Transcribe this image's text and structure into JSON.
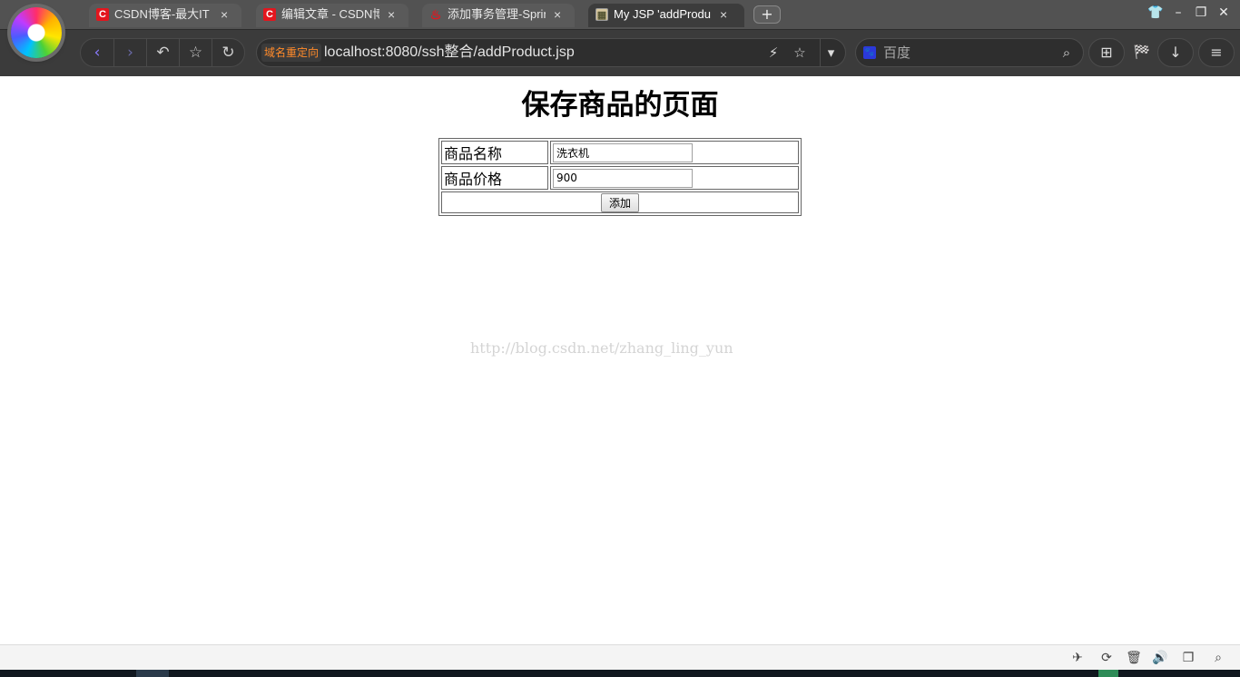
{
  "browser": {
    "tabs": [
      {
        "favicon": "C",
        "title": "CSDN博客-最大IT",
        "state": "inactive"
      },
      {
        "favicon": "C",
        "title": "编辑文章 - CSDN博",
        "state": "inactive"
      },
      {
        "favicon": "♨",
        "title": "添加事务管理-Sprin",
        "state": "inactive"
      },
      {
        "favicon": "▦",
        "title": "My JSP 'addProdu",
        "state": "active"
      }
    ],
    "tab_close_glyph": "×",
    "new_tab_glyph": "+",
    "window_controls": {
      "skin": "👕",
      "minimize": "–",
      "restore": "❐",
      "close": "✕"
    },
    "nav": {
      "back": "‹",
      "forward": "›",
      "undo": "↶",
      "favorite": "☆",
      "reload": "↻"
    },
    "address": {
      "redirect_badge": "域名重定向",
      "url": "localhost:8080/ssh整合/addProduct.jsp",
      "lightning": "⚡",
      "star": "☆",
      "dropdown": "▾"
    },
    "search": {
      "engine_icon": "🐾",
      "placeholder": "百度",
      "search_glyph": "⌕"
    },
    "tools": {
      "apps": "⊞",
      "game": "🏁",
      "download": "↓",
      "menu": "≡"
    },
    "colors": {
      "tabbar": "#525252",
      "toolbar": "#3b3b3b",
      "redirect_badge": "#ff8a2a"
    }
  },
  "page": {
    "title": "保存商品的页面",
    "form": {
      "rows": [
        {
          "label": "商品名称",
          "value": "洗衣机"
        },
        {
          "label": "商品价格",
          "value": "900"
        }
      ],
      "submit_label": "添加"
    },
    "watermark": "http://blog.csdn.net/zhang_ling_yun"
  },
  "statusbar": {
    "icons": [
      "✈",
      "⟳",
      "🗑",
      "🔊",
      "❐",
      "⌕"
    ]
  }
}
